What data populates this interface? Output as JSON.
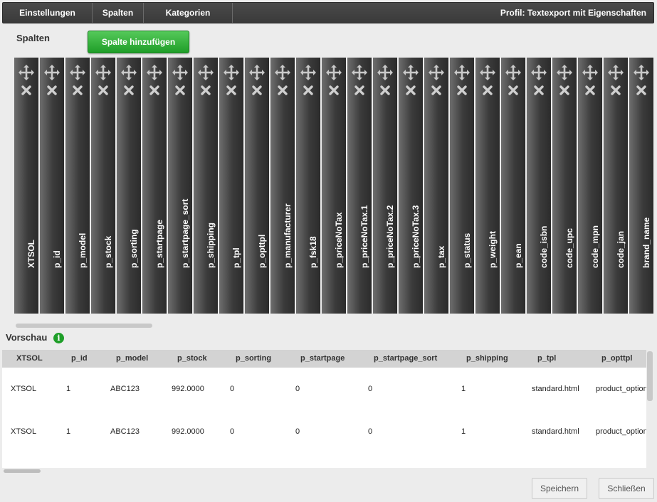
{
  "toolbar": {
    "tabs": [
      "Einstellungen",
      "Spalten",
      "Kategorien"
    ],
    "profile_title": "Profil: Textexport mit Eigenschaften"
  },
  "columns_section": {
    "title": "Spalten",
    "add_button": "Spalte hinzufügen",
    "columns": [
      "XTSOL",
      "p_id",
      "p_model",
      "p_stock",
      "p_sorting",
      "p_startpage",
      "p_startpage_sort",
      "p_shipping",
      "p_tpl",
      "p_opttpl",
      "p_manufacturer",
      "p_fsk18",
      "p_priceNoTax",
      "p_priceNoTax.1",
      "p_priceNoTax.2",
      "p_priceNoTax.3",
      "p_tax",
      "p_status",
      "p_weight",
      "p_ean",
      "code_isbn",
      "code_upc",
      "code_mpn",
      "code_jan",
      "brand_name"
    ],
    "icons": {
      "move": "move-arrows-icon",
      "delete": "delete-x-icon"
    }
  },
  "preview": {
    "title": "Vorschau",
    "info_icon": "i",
    "headers": [
      "XTSOL",
      "p_id",
      "p_model",
      "p_stock",
      "p_sorting",
      "p_startpage",
      "p_startpage_sort",
      "p_shipping",
      "p_tpl",
      "p_opttpl"
    ],
    "rows": [
      [
        "XTSOL",
        "1",
        "ABC123",
        "992.0000",
        "0",
        "0",
        "0",
        "1",
        "standard.html",
        "product_option"
      ],
      [
        "XTSOL",
        "1",
        "ABC123",
        "992.0000",
        "0",
        "0",
        "0",
        "1",
        "standard.html",
        "product_option"
      ]
    ]
  },
  "footer": {
    "save": "Speichern",
    "close": "Schließen"
  },
  "colors": {
    "toolbar": "#3a3a3a",
    "accent_green": "#1f9e28",
    "column_dark": "#2b2b2b"
  }
}
